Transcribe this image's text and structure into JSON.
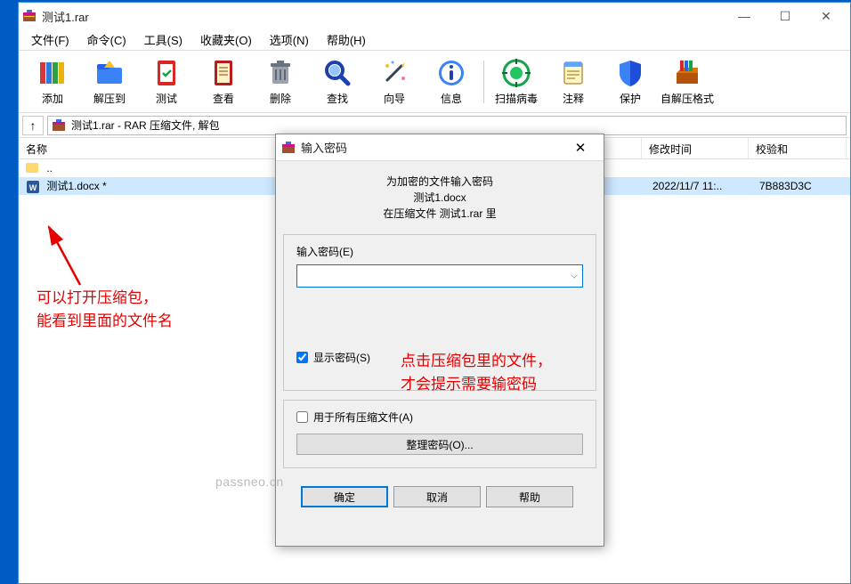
{
  "window": {
    "title": "测试1.rar"
  },
  "menubar": {
    "items": [
      {
        "label": "文件(F)"
      },
      {
        "label": "命令(C)"
      },
      {
        "label": "工具(S)"
      },
      {
        "label": "收藏夹(O)"
      },
      {
        "label": "选项(N)"
      },
      {
        "label": "帮助(H)"
      }
    ]
  },
  "toolbar": {
    "items": [
      {
        "name": "add-button",
        "label": "添加"
      },
      {
        "name": "extract-button",
        "label": "解压到"
      },
      {
        "name": "test-button",
        "label": "测试"
      },
      {
        "name": "view-button",
        "label": "查看"
      },
      {
        "name": "delete-button",
        "label": "删除"
      },
      {
        "name": "find-button",
        "label": "查找"
      },
      {
        "name": "wizard-button",
        "label": "向导"
      },
      {
        "name": "info-button",
        "label": "信息"
      },
      {
        "name": "scan-button",
        "label": "扫描病毒"
      },
      {
        "name": "comment-button",
        "label": "注释"
      },
      {
        "name": "protect-button",
        "label": "保护"
      },
      {
        "name": "sfx-button",
        "label": "自解压格式"
      }
    ]
  },
  "pathbar": {
    "text": "测试1.rar - RAR 压缩文件, 解包"
  },
  "columns": {
    "name": "名称",
    "date": "修改时间",
    "csum": "校验和"
  },
  "files": [
    {
      "name": "..",
      "type": "updir"
    },
    {
      "name": "测试1.docx *",
      "type": "docx",
      "date": "2022/11/7 11:..",
      "csum": "7B883D3C",
      "selected": true
    }
  ],
  "dialog": {
    "title": "输入密码",
    "header_line1": "为加密的文件输入密码",
    "header_line2": "测试1.docx",
    "header_line3": "在压缩文件 测试1.rar 里",
    "input_label": "输入密码(E)",
    "input_value": "",
    "show_pw_label": "显示密码(S)",
    "show_pw_checked": true,
    "all_archives_label": "用于所有压缩文件(A)",
    "all_archives_checked": false,
    "organize_label": "整理密码(O)...",
    "ok": "确定",
    "cancel": "取消",
    "help": "帮助"
  },
  "annotations": {
    "left1": "可以打开压缩包，",
    "left2": "能看到里面的文件名",
    "right1": "点击压缩包里的文件，",
    "right2": "才会提示需要输密码"
  },
  "watermark": "passneo.cn"
}
